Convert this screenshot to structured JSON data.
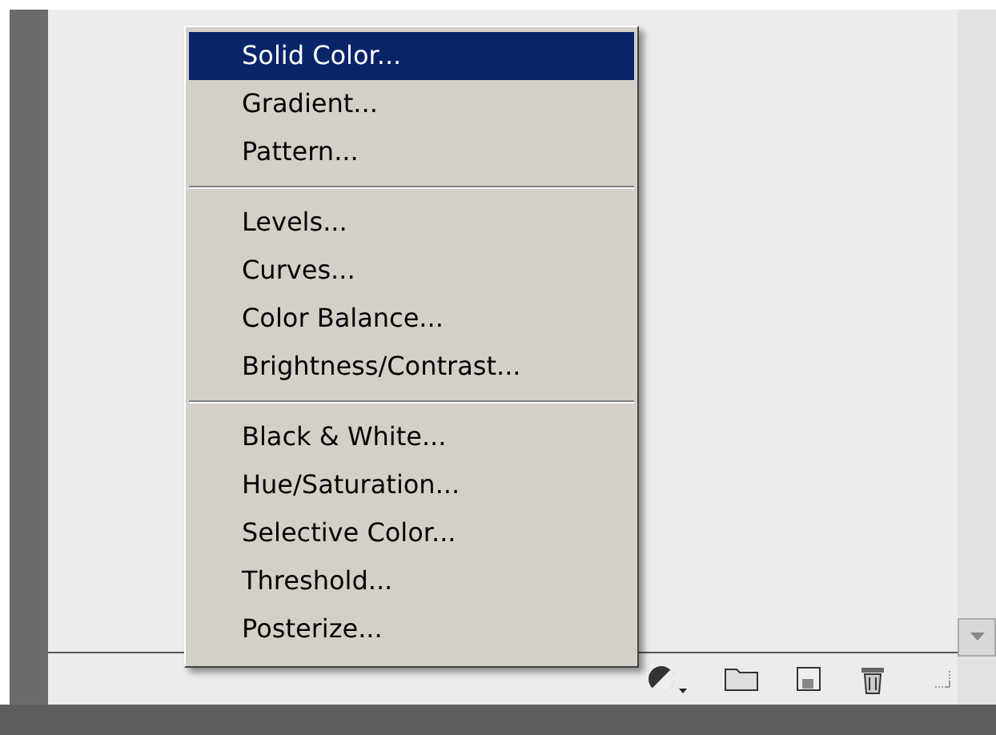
{
  "menu": {
    "groups": [
      [
        {
          "label": "Solid Color...",
          "selected": true
        },
        {
          "label": "Gradient...",
          "selected": false
        },
        {
          "label": "Pattern...",
          "selected": false
        }
      ],
      [
        {
          "label": "Levels...",
          "selected": false
        },
        {
          "label": "Curves...",
          "selected": false
        },
        {
          "label": "Color Balance...",
          "selected": false
        },
        {
          "label": "Brightness/Contrast...",
          "selected": false
        }
      ],
      [
        {
          "label": "Black & White...",
          "selected": false
        },
        {
          "label": "Hue/Saturation...",
          "selected": false
        },
        {
          "label": "Selective Color...",
          "selected": false
        },
        {
          "label": "Threshold...",
          "selected": false
        },
        {
          "label": "Posterize...",
          "selected": false
        }
      ]
    ]
  }
}
